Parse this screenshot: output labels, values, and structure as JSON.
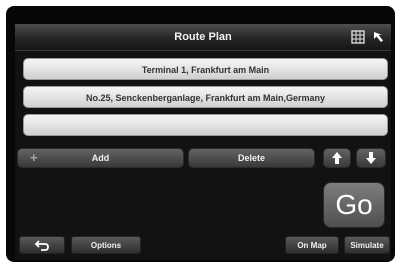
{
  "window": {
    "title": "Route Plan"
  },
  "route": {
    "stops": [
      "Terminal 1, Frankfurt am Main",
      "No.25, Senckenberganlage, Frankfurt am Main,Germany",
      ""
    ]
  },
  "actions": {
    "add_label": "Add",
    "delete_label": "Delete",
    "go_label": "Go"
  },
  "bottom_bar": {
    "options_label": "Options",
    "on_map_label": "On Map",
    "simulate_label": "Simulate"
  },
  "icons": {
    "top_right": [
      "map-grid-icon",
      "cursor-arrow-icon"
    ],
    "back": "back-arrow-icon",
    "move_up": "arrow-up-icon",
    "move_down": "arrow-down-icon",
    "add": "plus-icon"
  }
}
